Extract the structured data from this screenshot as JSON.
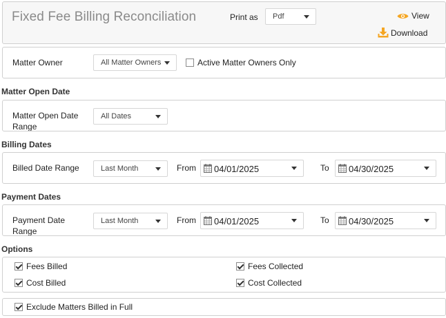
{
  "header": {
    "title": "Fixed Fee Billing Reconciliation",
    "print_as_label": "Print as",
    "print_as_value": "Pdf",
    "view_label": "View",
    "download_label": "Download"
  },
  "matter_owner": {
    "label": "Matter Owner",
    "value": "All Matter Owners",
    "active_only_label": "Active Matter Owners Only",
    "active_only_checked": false
  },
  "matter_open_date": {
    "section_title": "Matter Open Date",
    "label": "Matter Open Date Range",
    "value": "All Dates"
  },
  "billing_dates": {
    "section_title": "Billing Dates",
    "label": "Billed Date Range",
    "value": "Last Month",
    "from_label": "From",
    "from_date": "04/01/2025",
    "to_label": "To",
    "to_date": "04/30/2025"
  },
  "payment_dates": {
    "section_title": "Payment Dates",
    "label": "Payment Date Range",
    "value": "Last Month",
    "from_label": "From",
    "from_date": "04/01/2025",
    "to_label": "To",
    "to_date": "04/30/2025"
  },
  "options": {
    "section_title": "Options",
    "fees_billed": "Fees Billed",
    "fees_collected": "Fees Collected",
    "cost_billed": "Cost Billed",
    "cost_collected": "Cost Collected",
    "exclude_billed_in_full": "Exclude Matters Billed in Full"
  },
  "colors": {
    "accent_orange": "#f5a623",
    "title_gray": "#8a8a8a"
  },
  "icons": {
    "view": "eye-icon",
    "download": "download-icon",
    "calendar": "calendar-icon"
  }
}
